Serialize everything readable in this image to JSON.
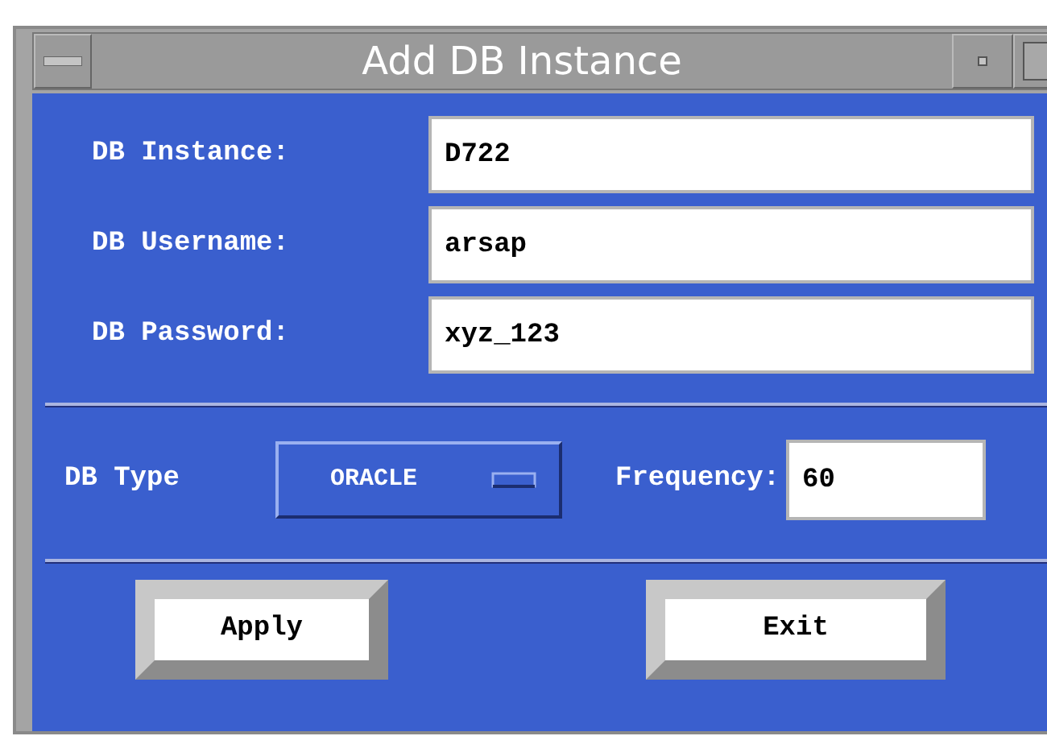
{
  "window": {
    "title": "Add DB Instance"
  },
  "fields": [
    {
      "label": "DB Instance:",
      "value": "D722"
    },
    {
      "label": "DB Username:",
      "value": "arsap"
    },
    {
      "label": "DB Password:",
      "value": "xyz_123"
    }
  ],
  "db_type": {
    "label": "DB Type",
    "value": "ORACLE"
  },
  "frequency": {
    "label": "Frequency:",
    "value": "60"
  },
  "buttons": [
    "Apply",
    "Exit"
  ]
}
